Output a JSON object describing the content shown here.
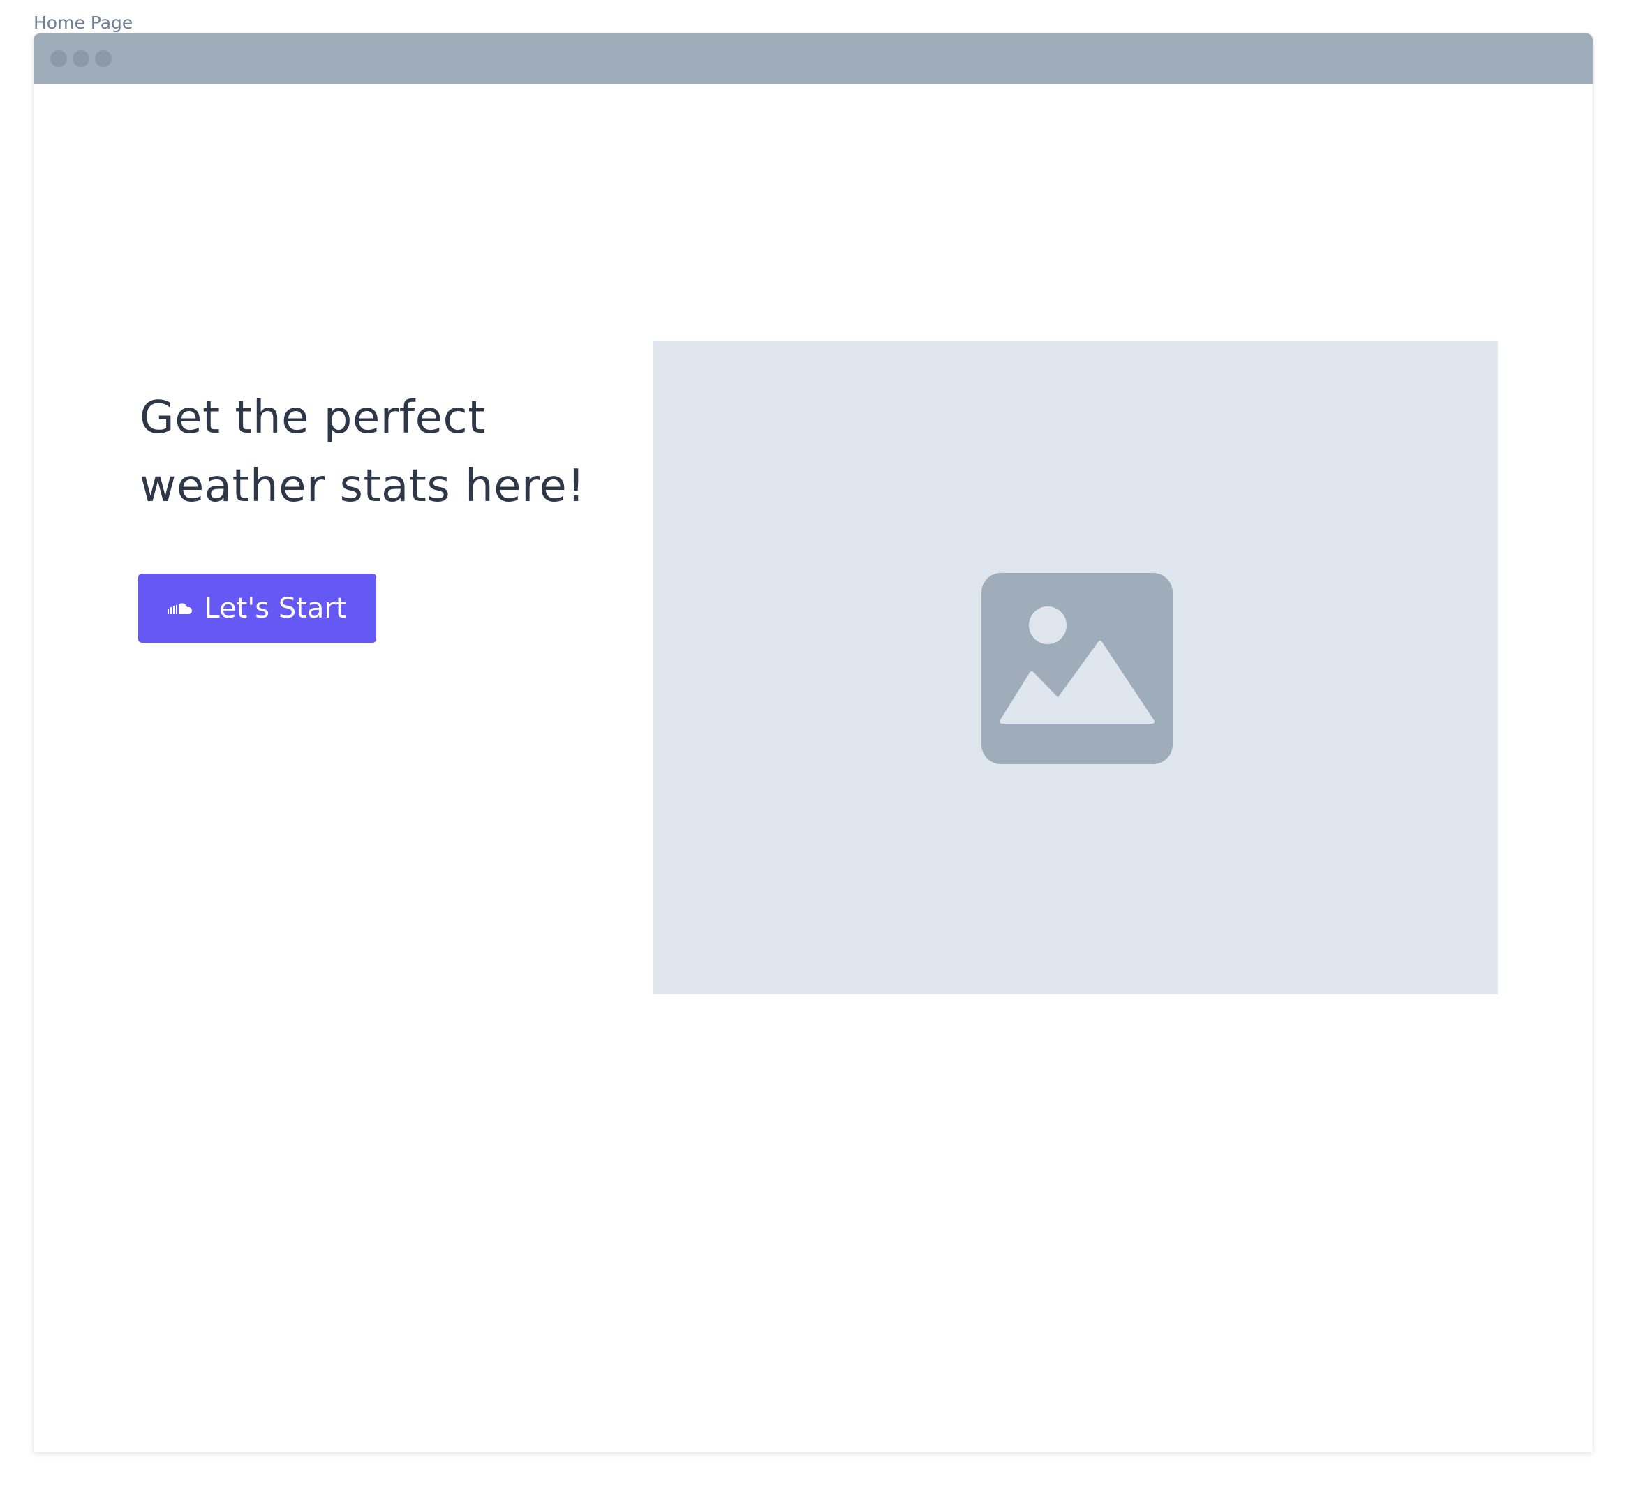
{
  "frame": {
    "label": "Home Page"
  },
  "hero": {
    "headline": "Get the perfect weather stats here!",
    "cta_label": "Let's Start",
    "cta_icon": "soundcloud-icon",
    "image_icon": "image-placeholder-icon"
  },
  "colors": {
    "titlebar": "#9eadb9",
    "accent": "#6558f5",
    "placeholder_bg": "#dfe6ee",
    "placeholder_icon": "#9eadb9",
    "headline_text": "#2d3748"
  }
}
